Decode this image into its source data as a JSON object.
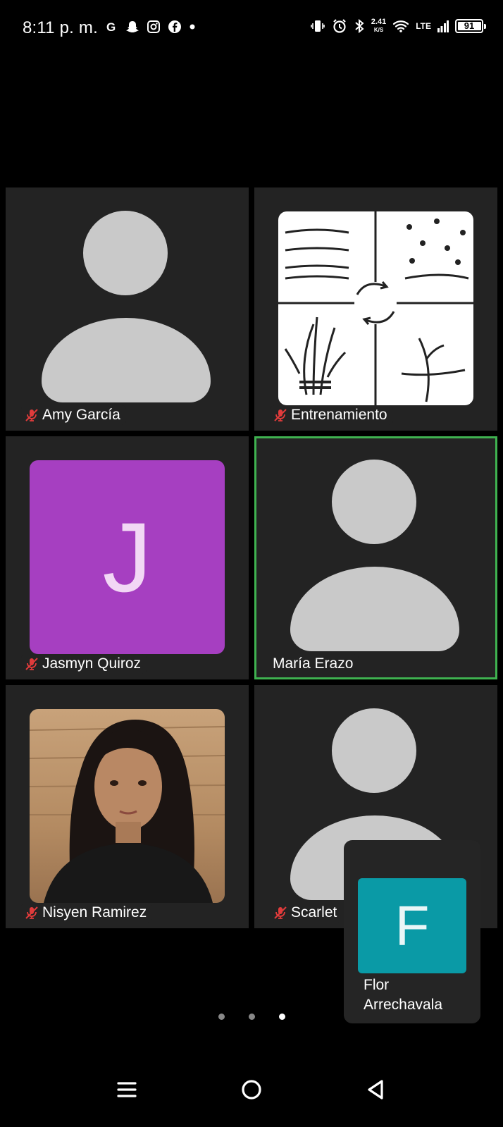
{
  "status_bar": {
    "time": "8:11 p. m.",
    "net_speed_value": "2.41",
    "net_speed_unit": "K/S",
    "network_type": "LTE",
    "battery_level": "91",
    "left_icons": [
      "google-icon",
      "snapchat-icon",
      "instagram-icon",
      "facebook-icon",
      "notification-dot-icon"
    ],
    "right_icons": [
      "vibrate-icon",
      "alarm-icon",
      "bluetooth-icon",
      "wifi-icon",
      "signal-icon",
      "battery-icon"
    ]
  },
  "participants": [
    {
      "name": "Amy García",
      "muted": true,
      "avatar": "generic"
    },
    {
      "name": "Entrenamiento",
      "muted": true,
      "avatar": "logo"
    },
    {
      "name": "Jasmyn Quiroz",
      "muted": true,
      "avatar": "initial",
      "initial": "J",
      "color": "#a63fc1"
    },
    {
      "name": "María Erazo",
      "muted": false,
      "avatar": "generic",
      "active_speaker": true
    },
    {
      "name": "Nisyen Ramirez",
      "muted": true,
      "avatar": "photo"
    },
    {
      "name": "Scarlet",
      "muted": true,
      "avatar": "generic"
    }
  ],
  "self_view": {
    "initial": "F",
    "name_line1": "Flor",
    "name_line2": "Arrechavala",
    "color": "#0a9aa6"
  },
  "pagination": {
    "pages": 3,
    "current": 3
  },
  "accent_colors": {
    "active_border": "#3fb250",
    "muted_icon": "#e03b3b"
  },
  "nav_bar": {
    "icons": [
      "recents-icon",
      "home-icon",
      "back-icon"
    ]
  }
}
